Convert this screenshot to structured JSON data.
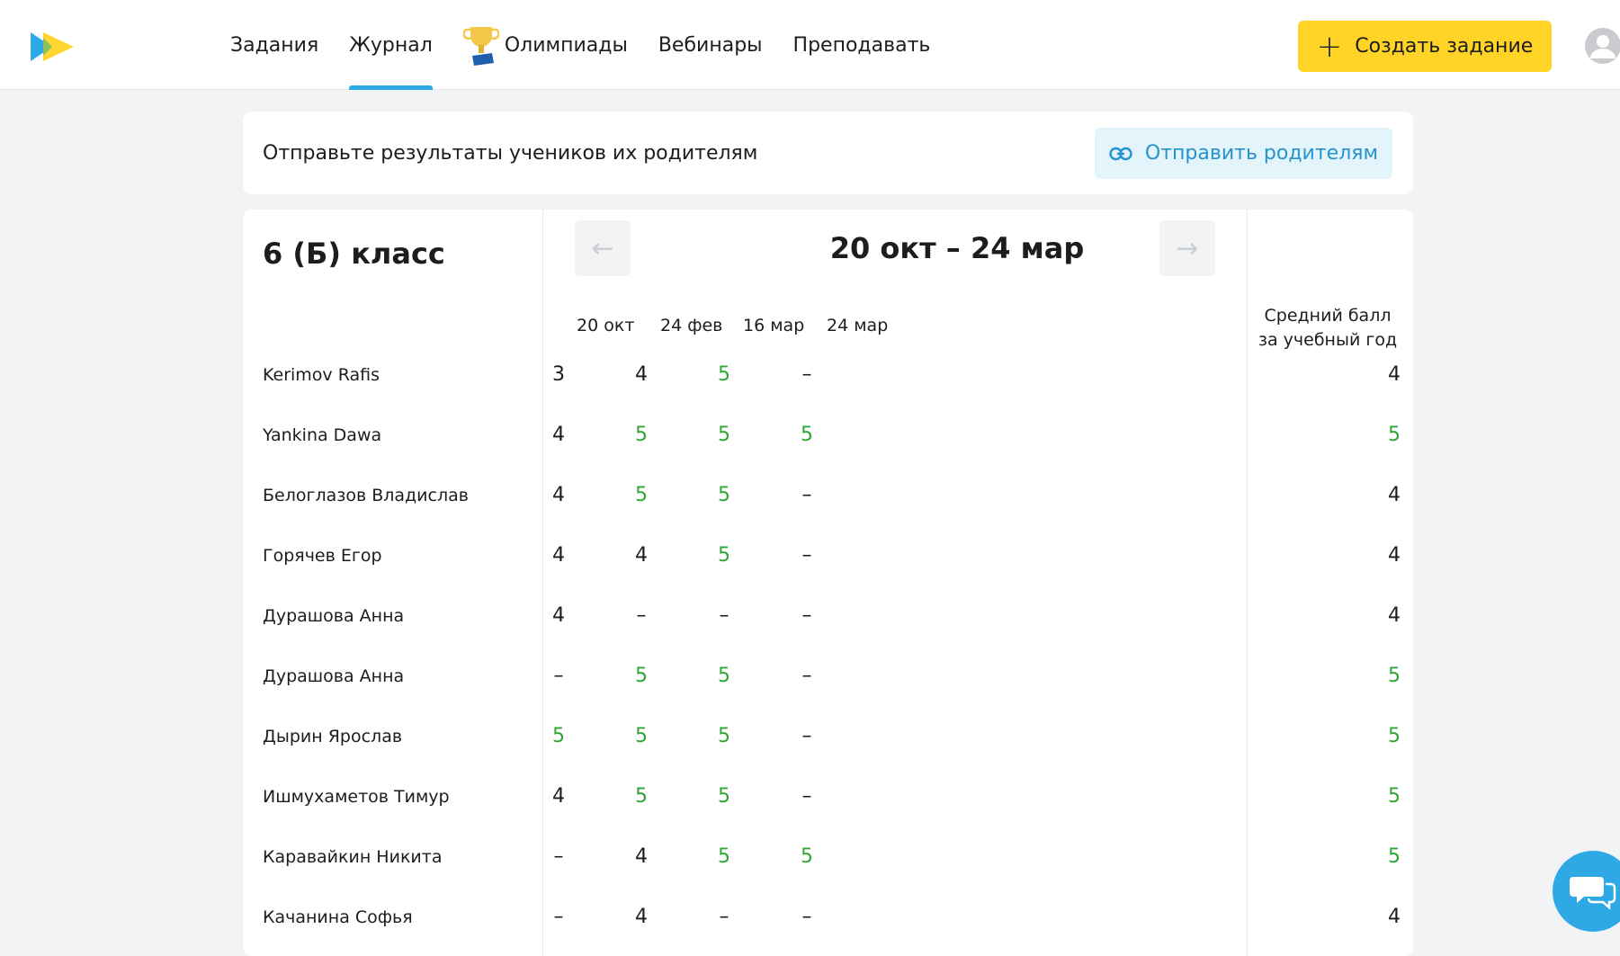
{
  "nav": {
    "items": [
      {
        "label": "Задания",
        "active": false
      },
      {
        "label": "Журнал",
        "active": true
      },
      {
        "label": "Олимпиады",
        "active": false,
        "icon": "trophy-icon"
      },
      {
        "label": "Вебинары",
        "active": false
      },
      {
        "label": "Преподавать",
        "active": false
      }
    ],
    "create_label": "Создать задание"
  },
  "colors": {
    "accent": "#2fa9e6",
    "brand_yellow": "#ffd426",
    "grade_five": "#30a637"
  },
  "send": {
    "text": "Отправьте результаты учеников их родителям",
    "button": "Отправить родителям"
  },
  "journal": {
    "class_title": "6 (Б) класс",
    "period": "20 окт – 24 мар",
    "prev_arrow": "←",
    "next_arrow": "→",
    "dates": [
      "20 окт",
      "24 фев",
      "16 мар",
      "24 мар"
    ],
    "avg_header_line1": "Средний балл",
    "avg_header_line2": "за учебный год",
    "students": [
      {
        "name": "Kerimov Rafis",
        "grades": [
          "3",
          "4",
          "5",
          "–"
        ],
        "avg": "4"
      },
      {
        "name": "Yankina Dawa",
        "grades": [
          "4",
          "5",
          "5",
          "5"
        ],
        "avg": "5"
      },
      {
        "name": "Белоглазов Владислав",
        "grades": [
          "4",
          "5",
          "5",
          "–"
        ],
        "avg": "4"
      },
      {
        "name": "Горячев Егор",
        "grades": [
          "4",
          "4",
          "5",
          "–"
        ],
        "avg": "4"
      },
      {
        "name": "Дурашова Анна",
        "grades": [
          "4",
          "–",
          "–",
          "–"
        ],
        "avg": "4"
      },
      {
        "name": "Дурашова Анна",
        "grades": [
          "–",
          "5",
          "5",
          "–"
        ],
        "avg": "5"
      },
      {
        "name": "Дырин Ярослав",
        "grades": [
          "5",
          "5",
          "5",
          "–"
        ],
        "avg": "5"
      },
      {
        "name": "Ишмухаметов Тимур",
        "grades": [
          "4",
          "5",
          "5",
          "–"
        ],
        "avg": "5"
      },
      {
        "name": "Каравайкин Никита",
        "grades": [
          "–",
          "4",
          "5",
          "5"
        ],
        "avg": "5"
      },
      {
        "name": "Качанина Софья",
        "grades": [
          "–",
          "4",
          "–",
          "–"
        ],
        "avg": "4"
      }
    ]
  }
}
